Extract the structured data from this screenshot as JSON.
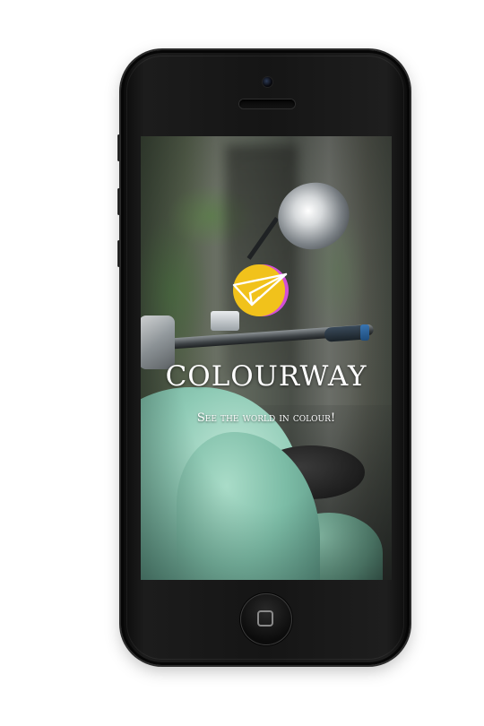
{
  "app": {
    "title": "COLOURWAY",
    "tagline": "See the world in colour!"
  },
  "logo": {
    "icon": "paper-plane-icon",
    "circle_color": "#f1c21b",
    "accent_color": "#d24fd6"
  },
  "device": {
    "home_button_icon": "home-square-icon"
  }
}
